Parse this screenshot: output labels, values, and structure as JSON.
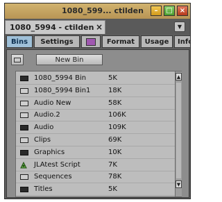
{
  "window": {
    "title": "1080_599... ctilden",
    "min_glyph": "–",
    "max_glyph": "□",
    "close_glyph": "×"
  },
  "tab": {
    "label": "1080_5994 - ctilden",
    "close_glyph": "×",
    "menu_glyph": "▼"
  },
  "subtabs": {
    "bins": "Bins",
    "settings": "Settings",
    "format": "Format",
    "usage": "Usage",
    "info": "Info"
  },
  "toolbar": {
    "new_bin_label": "New Bin"
  },
  "bins": [
    {
      "name": "1080_5994 Bin",
      "size": "5K",
      "icon": "bin-filled-icon"
    },
    {
      "name": "1080_5994 Bin1",
      "size": "18K",
      "icon": "bin-empty-icon"
    },
    {
      "name": "Audio New",
      "size": "58K",
      "icon": "bin-empty-icon"
    },
    {
      "name": "Audio.2",
      "size": "106K",
      "icon": "bin-empty-icon"
    },
    {
      "name": "Audio",
      "size": "109K",
      "icon": "bin-filled-icon"
    },
    {
      "name": "Clips",
      "size": "69K",
      "icon": "bin-empty-icon"
    },
    {
      "name": "Graphics",
      "size": "10K",
      "icon": "bin-filled-icon"
    },
    {
      "name": "JLAtest Script",
      "size": "7K",
      "icon": "script-icon"
    },
    {
      "name": "Sequences",
      "size": "78K",
      "icon": "bin-empty-icon"
    },
    {
      "name": "Titles",
      "size": "5K",
      "icon": "bin-filled-icon"
    }
  ],
  "scroll": {
    "up_glyph": "▲",
    "down_glyph": "▼"
  },
  "colors": {
    "titlebar": "#c8a866",
    "active_subtab": "#9fc0d8",
    "list_bg": "#bdbdbd"
  }
}
